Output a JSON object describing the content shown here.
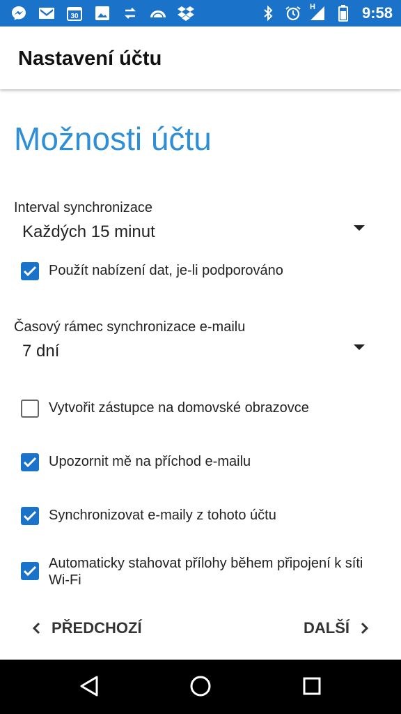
{
  "status_bar": {
    "time": "9:58",
    "left_icons": [
      "messenger-icon",
      "gmail-icon",
      "calendar-icon",
      "photos-icon",
      "sync-icon",
      "cloud-icon",
      "dropbox-icon"
    ],
    "calendar_day": "30",
    "network_label": "H",
    "right_icons": [
      "bluetooth-icon",
      "alarm-icon",
      "signal-icon",
      "battery-icon"
    ]
  },
  "app_bar": {
    "title": "Nastavení účtu"
  },
  "heading": "Možnosti účtu",
  "sync_interval": {
    "label": "Interval synchronizace",
    "value": "Každých 15 minut"
  },
  "push_option": {
    "label": "Použít nabízení dat, je-li podporováno",
    "checked": true
  },
  "sync_window": {
    "label": "Časový rámec synchronizace e-mailu",
    "value": "7 dní"
  },
  "options": [
    {
      "label": "Vytvořit zástupce na domovské obrazovce",
      "checked": false
    },
    {
      "label": "Upozornit mě na příchod e-mailu",
      "checked": true
    },
    {
      "label": "Synchronizovat e-maily z tohoto účtu",
      "checked": true
    },
    {
      "label": "Automaticky stahovat přílohy během připojení k síti Wi-Fi",
      "checked": true
    }
  ],
  "nav": {
    "prev_label": "PŘEDCHOZÍ",
    "next_label": "DALŠÍ"
  },
  "colors": {
    "accent": "#1a73c8",
    "heading": "#2f8fd6"
  }
}
